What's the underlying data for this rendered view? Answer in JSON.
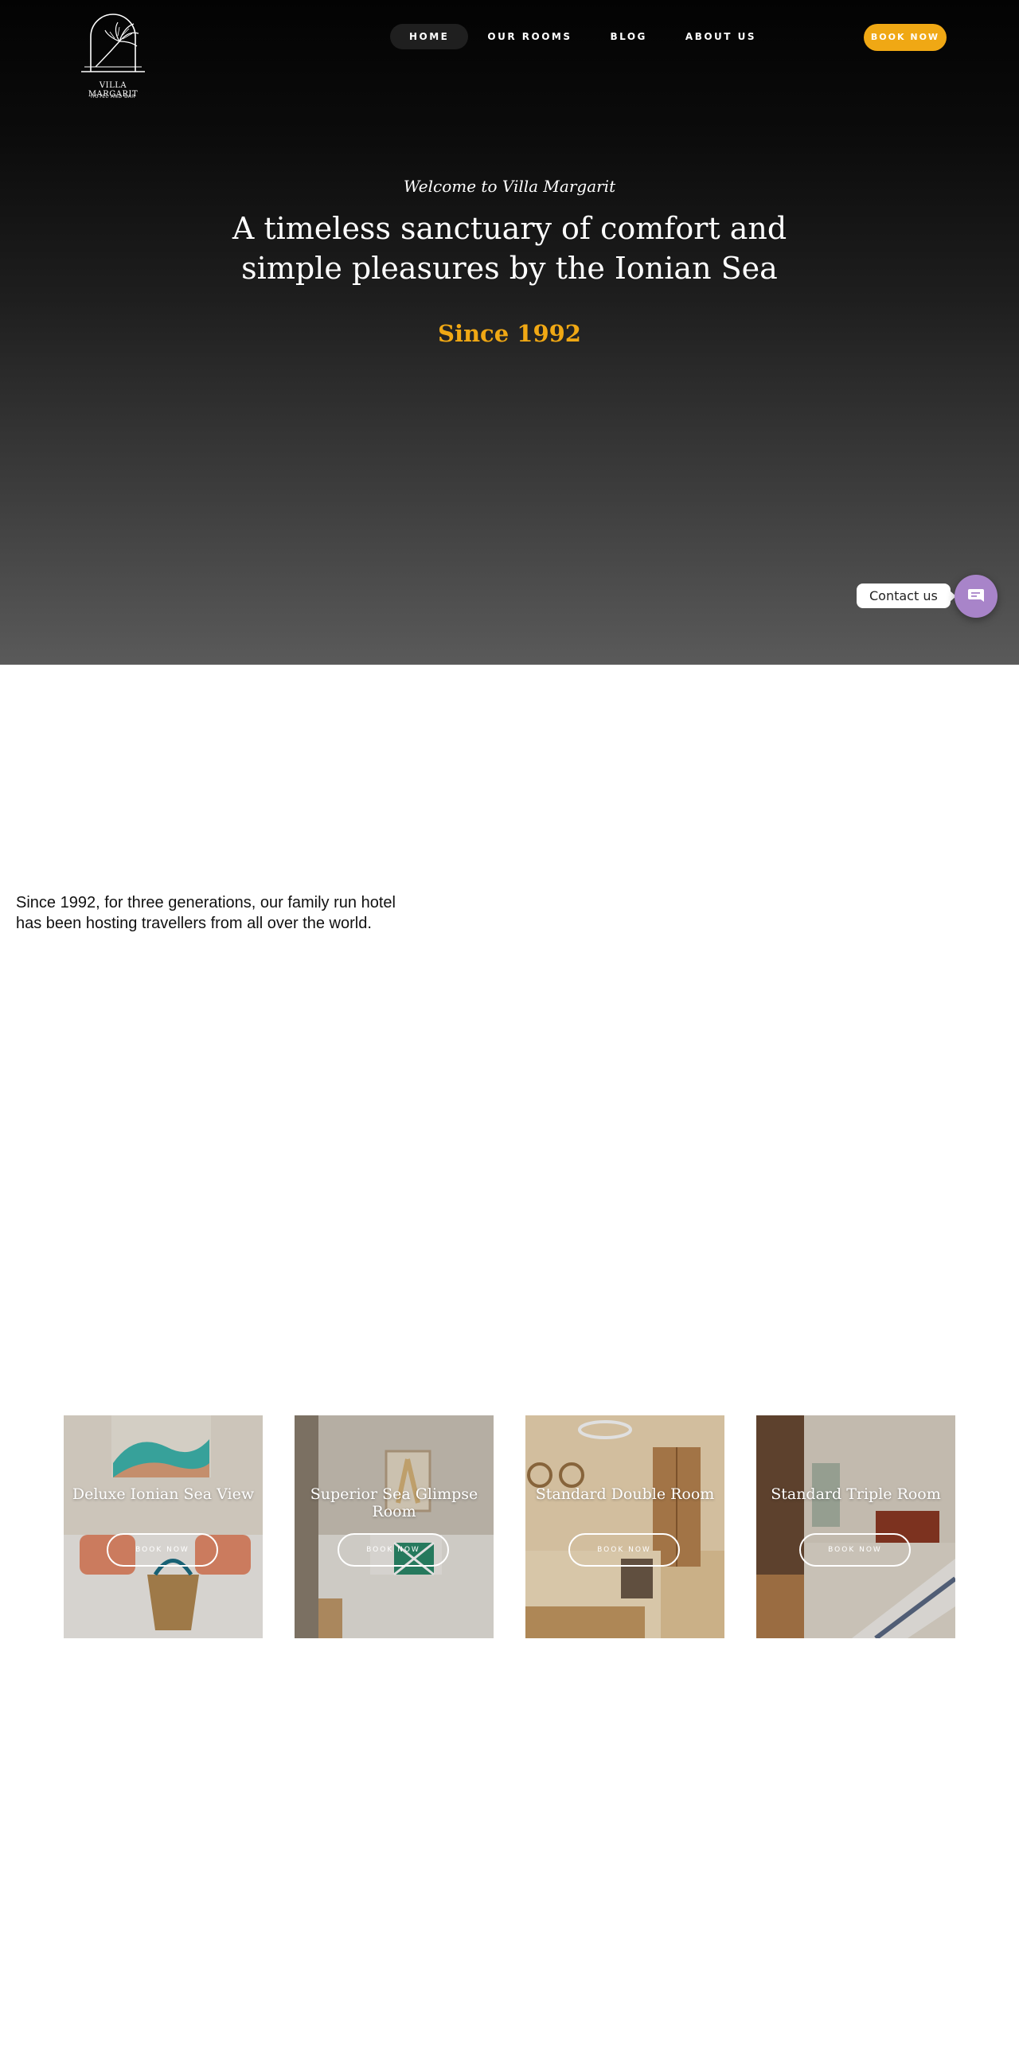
{
  "brand": {
    "name": "VILLA MARGARIT",
    "tagline": "HOTEL AND BAR"
  },
  "nav": {
    "items": [
      {
        "label": "HOME",
        "active": true
      },
      {
        "label": "OUR ROOMS",
        "active": false
      },
      {
        "label": "BLOG",
        "active": false
      },
      {
        "label": "ABOUT US",
        "active": false
      }
    ],
    "book_label": "BOOK NOW"
  },
  "hero": {
    "welcome": "Welcome to Villa Margarit",
    "headline": "A timeless sanctuary of comfort and simple pleasures by the Ionian Sea",
    "since": "Since 1992"
  },
  "contact": {
    "label": "Contact us",
    "icon": "chat-icon"
  },
  "intro": {
    "text": "Since 1992, for three generations, our family run hotel has been hosting travellers from all over the world."
  },
  "rooms": [
    {
      "title": "Deluxe Ionian Sea View",
      "button": "BOOK NOW"
    },
    {
      "title": "Superior Sea Glimpse Room",
      "button": "BOOK NOW"
    },
    {
      "title": "Standard Double Room",
      "button": "BOOK NOW"
    },
    {
      "title": "Standard Triple Room",
      "button": "BOOK NOW"
    }
  ],
  "colors": {
    "accent": "#f0a814",
    "contact": "#a884c9"
  }
}
